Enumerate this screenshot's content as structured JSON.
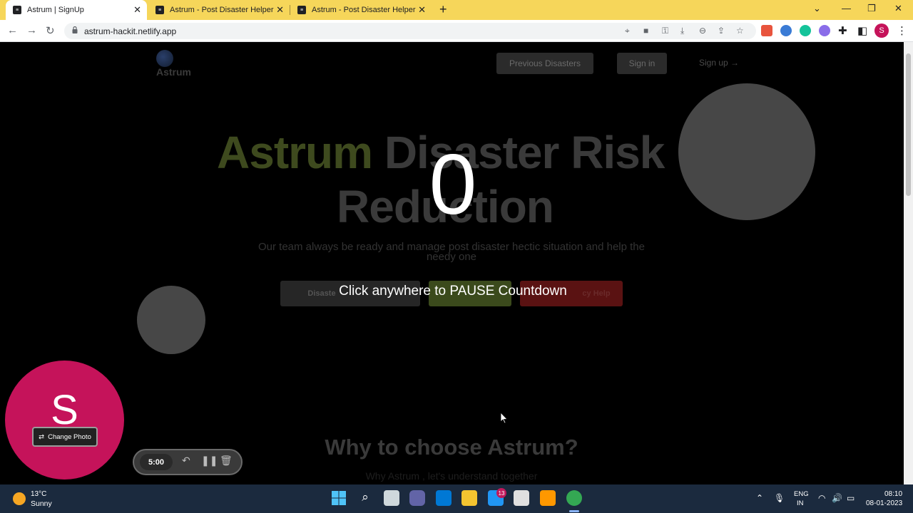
{
  "browser": {
    "tabs": [
      {
        "title": "Astrum | SignUp",
        "active": true
      },
      {
        "title": "Astrum - Post Disaster Helper",
        "active": false
      },
      {
        "title": "Astrum - Post Disaster Helper",
        "active": false
      }
    ],
    "new_tab_label": "+",
    "url": "astrum-hackit.netlify.app",
    "profile_initial": "S"
  },
  "site": {
    "logo_text": "Astrum",
    "nav": {
      "previous_disasters": "Previous Disasters",
      "sign_in": "Sign in",
      "sign_up": "Sign up →"
    },
    "hero": {
      "title_accent": "Astrum",
      "title_rest_line1": "Disaster Risk",
      "title_line2": "Reduction",
      "subtitle": "Our team always be ready and manage post disaster hectic situation and help the needy one"
    },
    "cta": {
      "first": "Disaste",
      "third": "cy Help"
    },
    "why": {
      "title": "Why to choose Astrum?",
      "subtitle": "Why Astrum , let's understand together"
    }
  },
  "overlay": {
    "countdown_value": "0",
    "pause_message": "Click anywhere to PAUSE Countdown"
  },
  "recorder": {
    "webcam_initial": "S",
    "change_photo_label": "Change Photo",
    "timer": "5:00",
    "webcam_color": "#c5135a"
  },
  "taskbar": {
    "weather_temp": "13°C",
    "weather_desc": "Sunny",
    "lang_line1": "ENG",
    "lang_line2": "IN",
    "time": "08:10",
    "date": "08-01-2023",
    "badge_count": "13"
  },
  "colors": {
    "tabstrip": "#f6d65a",
    "accent_green": "#3e4a1e",
    "cta_green": "#3b4a1c",
    "cta_red": "#5a1212"
  }
}
